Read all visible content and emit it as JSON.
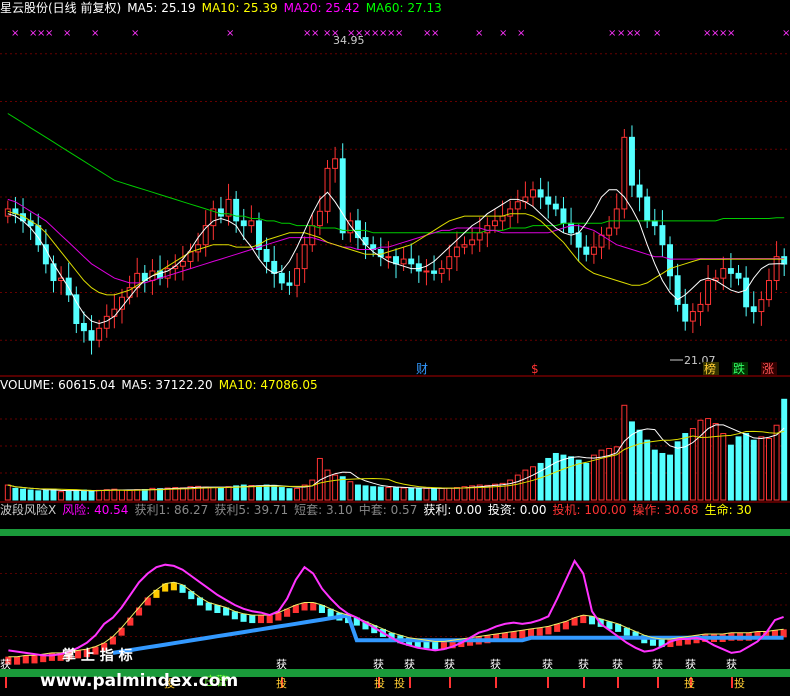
{
  "main_header": {
    "title": "星云股份(日线 前复权)",
    "ma5_label": "MA5: 25.19",
    "ma10_label": "MA10: 25.39",
    "ma20_label": "MA20: 25.42",
    "ma60_label": "MA60: 27.13",
    "colors": {
      "title": "#ffffff",
      "ma5": "#ffffff",
      "ma10": "#ffff00",
      "ma20": "#ff00ff",
      "ma60": "#00ff00"
    }
  },
  "volume_header": {
    "volume_label": "VOLUME: 60615.04",
    "ma5_label": "MA5: 37122.20",
    "ma10_label": "MA10: 47086.05"
  },
  "indicator_header": {
    "name": "波段风险X",
    "fengxian": "风险: 40.54",
    "huoli1": "获利1: 86.27",
    "huoli5": "获利5: 39.71",
    "duantao": "短套: 3.10",
    "zhongtao": "中套: 0.57",
    "huoli": "获利: 0.00",
    "touzi": "投资: 0.00",
    "touji": "投机: 100.00",
    "caozuo": "操作: 30.68",
    "shengming": "生命: 30"
  },
  "annotations": {
    "high_label": "34.95",
    "low_label": "21.07",
    "badge_cai": "财",
    "badge_s": "$",
    "badge_bang": "榜",
    "badge_die": "跌",
    "badge_zhang": "涨",
    "marker_x": "×",
    "signal_huo": "获",
    "signal_tou": "投",
    "band_label": "庄警",
    "watermark_cn": "掌 上 指 标",
    "watermark_url": "www.palmindex.com"
  },
  "chart_data": [
    {
      "type": "candlestick",
      "ylim": [
        20.5,
        35.5
      ],
      "grid": true,
      "high_marker": 34.95,
      "low_marker": 21.07,
      "open": [
        27.2,
        27.5,
        27.3,
        27.0,
        26.8,
        26.0,
        25.2,
        24.5,
        24.6,
        23.9,
        22.7,
        22.4,
        22.0,
        22.5,
        23.0,
        23.3,
        23.8,
        24.2,
        24.8,
        24.5,
        24.9,
        24.6,
        25.0,
        25.1,
        25.3,
        25.7,
        26.0,
        26.8,
        27.5,
        27.2,
        27.9,
        27.0,
        26.8,
        27.0,
        25.8,
        25.3,
        24.8,
        24.4,
        24.3,
        25.0,
        26.0,
        26.8,
        27.4,
        29.2,
        29.6,
        26.5,
        27.0,
        26.3,
        26.0,
        25.8,
        25.5,
        25.5,
        25.2,
        25.4,
        25.2,
        24.9,
        24.9,
        24.8,
        25.0,
        25.5,
        25.9,
        26.0,
        26.2,
        26.5,
        26.8,
        27.0,
        27.2,
        27.5,
        27.8,
        28.0,
        28.3,
        28.0,
        27.7,
        27.5,
        26.9,
        26.5,
        25.9,
        25.6,
        25.9,
        26.4,
        26.7,
        27.5,
        30.5,
        28.5,
        28.0,
        27.0,
        26.8,
        26.0,
        24.7,
        23.5,
        22.8,
        23.2,
        23.5,
        24.5,
        24.6,
        25.0,
        24.8,
        24.6,
        23.4,
        23.2,
        23.7,
        24.5,
        25.5
      ],
      "close": [
        27.5,
        27.3,
        27.0,
        26.8,
        26.0,
        25.2,
        24.5,
        24.6,
        23.9,
        22.7,
        22.4,
        22.0,
        22.5,
        23.0,
        23.3,
        23.8,
        24.2,
        24.8,
        24.5,
        24.9,
        24.6,
        25.0,
        25.1,
        25.3,
        25.7,
        26.0,
        26.8,
        27.5,
        27.2,
        27.9,
        27.0,
        26.8,
        27.0,
        25.8,
        25.3,
        24.8,
        24.4,
        24.3,
        25.0,
        26.0,
        26.8,
        27.4,
        29.2,
        29.6,
        26.5,
        27.0,
        26.3,
        26.0,
        25.8,
        25.5,
        25.5,
        25.2,
        25.4,
        25.2,
        24.9,
        24.9,
        24.8,
        25.0,
        25.5,
        25.9,
        26.0,
        26.2,
        26.5,
        26.8,
        27.0,
        27.2,
        27.5,
        27.8,
        28.0,
        28.3,
        28.0,
        27.7,
        27.5,
        26.9,
        26.5,
        25.9,
        25.6,
        25.9,
        26.4,
        26.7,
        27.5,
        30.5,
        28.5,
        28.0,
        27.0,
        26.8,
        26.0,
        24.7,
        23.5,
        22.8,
        23.2,
        23.5,
        24.5,
        24.6,
        25.0,
        24.8,
        24.6,
        23.4,
        23.2,
        23.7,
        24.5,
        25.5,
        25.19
      ],
      "ma5": [
        27.3,
        27.2,
        27.0,
        26.7,
        26.3,
        25.8,
        25.2,
        24.7,
        24.2,
        23.6,
        23.1,
        22.8,
        22.7,
        22.8,
        23.0,
        23.4,
        23.8,
        24.2,
        24.5,
        24.7,
        24.8,
        24.9,
        25.1,
        25.4,
        25.8,
        26.3,
        26.7,
        27.0,
        27.1,
        27.0,
        26.8,
        26.3,
        25.9,
        25.4,
        25.0,
        24.8,
        24.9,
        25.3,
        25.9,
        26.6,
        27.3,
        27.9,
        28.2,
        27.8,
        27.3,
        26.8,
        26.4,
        26.0,
        25.7,
        25.5,
        25.3,
        25.2,
        25.1,
        25.0,
        25.0,
        25.1,
        25.3,
        25.6,
        25.9,
        26.2,
        26.5,
        26.8,
        27.0,
        27.3,
        27.5,
        27.7,
        27.9,
        27.9,
        27.8,
        27.6,
        27.3,
        27.0,
        26.7,
        26.5,
        26.4,
        26.5,
        26.9,
        27.4,
        28.0,
        28.3,
        28.3,
        28.0,
        27.5,
        26.9,
        26.0,
        25.2,
        24.5,
        24.0,
        23.7,
        23.9,
        24.2,
        24.5,
        24.6,
        24.5,
        24.3,
        24.1,
        24.0,
        24.1,
        24.6,
        25.0,
        25.19,
        25.2,
        25.2
      ],
      "ma10": [
        27.4,
        27.3,
        27.2,
        27.0,
        26.8,
        26.5,
        26.1,
        25.7,
        25.3,
        24.9,
        24.5,
        24.2,
        24.0,
        23.9,
        23.9,
        24.0,
        24.1,
        24.3,
        24.5,
        24.7,
        24.9,
        25.1,
        25.3,
        25.5,
        25.7,
        25.8,
        25.9,
        26.0,
        26.0,
        26.0,
        25.9,
        25.9,
        25.9,
        26.0,
        26.2,
        26.3,
        26.4,
        26.5,
        26.5,
        26.5,
        26.4,
        26.3,
        26.1,
        26.0,
        25.9,
        25.8,
        25.7,
        25.6,
        25.6,
        25.6,
        25.7,
        25.8,
        25.9,
        26.0,
        26.2,
        26.4,
        26.6,
        26.8,
        27.0,
        27.1,
        27.2,
        27.2,
        27.2,
        27.2,
        27.2,
        27.2,
        27.3,
        27.3,
        27.3,
        27.2,
        27.0,
        26.7,
        26.4,
        26.1,
        25.7,
        25.3,
        25.0,
        24.8,
        24.7,
        24.6,
        24.5,
        24.4,
        24.3,
        24.3,
        24.4,
        24.6,
        24.8,
        25.0,
        25.1,
        25.2,
        25.3,
        25.4,
        25.39,
        25.39,
        25.39,
        25.4,
        25.4,
        25.4,
        25.4,
        25.4,
        25.4,
        25.4,
        25.4
      ],
      "ma20": [
        27.9,
        27.8,
        27.6,
        27.4,
        27.2,
        27.0,
        26.7,
        26.4,
        26.1,
        25.8,
        25.5,
        25.2,
        25.0,
        24.8,
        24.6,
        24.5,
        24.4,
        24.4,
        24.4,
        24.5,
        24.6,
        24.7,
        24.8,
        24.9,
        25.0,
        25.1,
        25.2,
        25.3,
        25.4,
        25.5,
        25.6,
        25.7,
        25.8,
        25.9,
        26.0,
        26.1,
        26.2,
        26.3,
        26.3,
        26.3,
        26.3,
        26.2,
        26.1,
        26.0,
        25.9,
        25.9,
        25.8,
        25.8,
        25.8,
        25.9,
        25.9,
        26.0,
        26.1,
        26.2,
        26.3,
        26.4,
        26.5,
        26.6,
        26.6,
        26.7,
        26.7,
        26.7,
        26.7,
        26.6,
        26.6,
        26.5,
        26.5,
        26.5,
        26.5,
        26.5,
        26.5,
        26.5,
        26.6,
        26.7,
        26.8,
        26.8,
        26.7,
        26.6,
        26.4,
        26.2,
        26.0,
        25.9,
        25.8,
        25.7,
        25.6,
        25.5,
        25.5,
        25.4,
        25.4,
        25.4,
        25.4,
        25.42,
        25.42,
        25.42,
        25.42,
        25.42,
        25.42,
        25.42,
        25.42,
        25.42,
        25.42,
        25.42,
        25.42
      ],
      "ma60": [
        31.5,
        31.3,
        31.1,
        30.9,
        30.7,
        30.5,
        30.3,
        30.1,
        29.9,
        29.7,
        29.5,
        29.3,
        29.1,
        28.9,
        28.7,
        28.6,
        28.5,
        28.4,
        28.3,
        28.2,
        28.1,
        28.0,
        27.9,
        27.8,
        27.7,
        27.6,
        27.5,
        27.4,
        27.3,
        27.3,
        27.2,
        27.2,
        27.1,
        27.1,
        27.0,
        27.0,
        26.9,
        26.9,
        26.8,
        26.8,
        26.8,
        26.7,
        26.7,
        26.7,
        26.6,
        26.6,
        26.6,
        26.6,
        26.5,
        26.5,
        26.5,
        26.5,
        26.5,
        26.5,
        26.5,
        26.5,
        26.5,
        26.5,
        26.5,
        26.5,
        26.5,
        26.5,
        26.5,
        26.6,
        26.6,
        26.6,
        26.7,
        26.7,
        26.7,
        26.8,
        26.8,
        26.8,
        26.8,
        26.9,
        26.9,
        26.9,
        26.9,
        26.9,
        26.9,
        27.0,
        27.0,
        27.0,
        27.0,
        27.0,
        27.0,
        27.0,
        27.0,
        27.0,
        27.0,
        27.0,
        27.0,
        27.0,
        27.0,
        27.0,
        27.1,
        27.1,
        27.1,
        27.1,
        27.1,
        27.1,
        27.1,
        27.13,
        27.13
      ]
    },
    {
      "type": "bar",
      "series": [
        {
          "name": "VOLUME",
          "values": [
            9000,
            7000,
            6500,
            6000,
            5500,
            6000,
            6500,
            5000,
            5200,
            5800,
            6000,
            5500,
            5800,
            6200,
            6500,
            6000,
            5800,
            6200,
            6300,
            7000,
            6800,
            7200,
            7500,
            7300,
            8000,
            8200,
            7800,
            7500,
            7200,
            8000,
            8500,
            9000,
            8700,
            8500,
            9000,
            8800,
            7500,
            6800,
            7000,
            9000,
            12000,
            25000,
            18000,
            15000,
            14000,
            11000,
            9000,
            8500,
            8000,
            7800,
            7500,
            7400,
            7200,
            7000,
            7100,
            7000,
            6900,
            7000,
            7100,
            7500,
            8000,
            8500,
            9000,
            8800,
            9500,
            10000,
            12000,
            15000,
            18000,
            20000,
            22000,
            25000,
            28000,
            27000,
            26000,
            24000,
            22000,
            27000,
            30000,
            31000,
            32000,
            57000,
            47000,
            42000,
            36000,
            30000,
            28000,
            27000,
            35000,
            40000,
            43000,
            48000,
            49000,
            46000,
            40000,
            33000,
            38000,
            40000,
            36000,
            38000,
            37000,
            45000,
            60615
          ]
        }
      ],
      "ylim": [
        0,
        65000
      ]
    },
    {
      "type": "line",
      "series": [
        {
          "name": "风险",
          "values": [
            14,
            13,
            12,
            11,
            10,
            10,
            11,
            13,
            16,
            20,
            26,
            35,
            40,
            48,
            58,
            68,
            75,
            80,
            82,
            81,
            78,
            73,
            68,
            63,
            58,
            54,
            50,
            47,
            45,
            44,
            42,
            45,
            55,
            70,
            80,
            75,
            63,
            55,
            48,
            43,
            40,
            36,
            32,
            28,
            24,
            20,
            18,
            16,
            15,
            14,
            15,
            17,
            20,
            24,
            28,
            30,
            33,
            35,
            36,
            35,
            36,
            38,
            41,
            55,
            70,
            85,
            75,
            45,
            35,
            30,
            25,
            20,
            16,
            13,
            14,
            17,
            21,
            23,
            23,
            24,
            22,
            18,
            15,
            12,
            13,
            17,
            21,
            28,
            38,
            40.54
          ]
        },
        {
          "name": "操作",
          "values": [
            9,
            9,
            10,
            10,
            11,
            12,
            12,
            13,
            14,
            15,
            17,
            20,
            25,
            32,
            40,
            48,
            56,
            62,
            67,
            68,
            66,
            61,
            56,
            52,
            50,
            48,
            45,
            43,
            42,
            42,
            42,
            44,
            47,
            50,
            52,
            52,
            50,
            47,
            44,
            42,
            40,
            37,
            34,
            31,
            28,
            26,
            24,
            23,
            22,
            21,
            21,
            22,
            23,
            24,
            25,
            26,
            27,
            28,
            29,
            30,
            31,
            32,
            33,
            35,
            37,
            40,
            42,
            41,
            39,
            37,
            35,
            32,
            29,
            26,
            24,
            23,
            23,
            24,
            25,
            26,
            27,
            27,
            27,
            28,
            28,
            28,
            29,
            29,
            30,
            30.68
          ]
        }
      ],
      "ylim": [
        0,
        100
      ]
    }
  ]
}
